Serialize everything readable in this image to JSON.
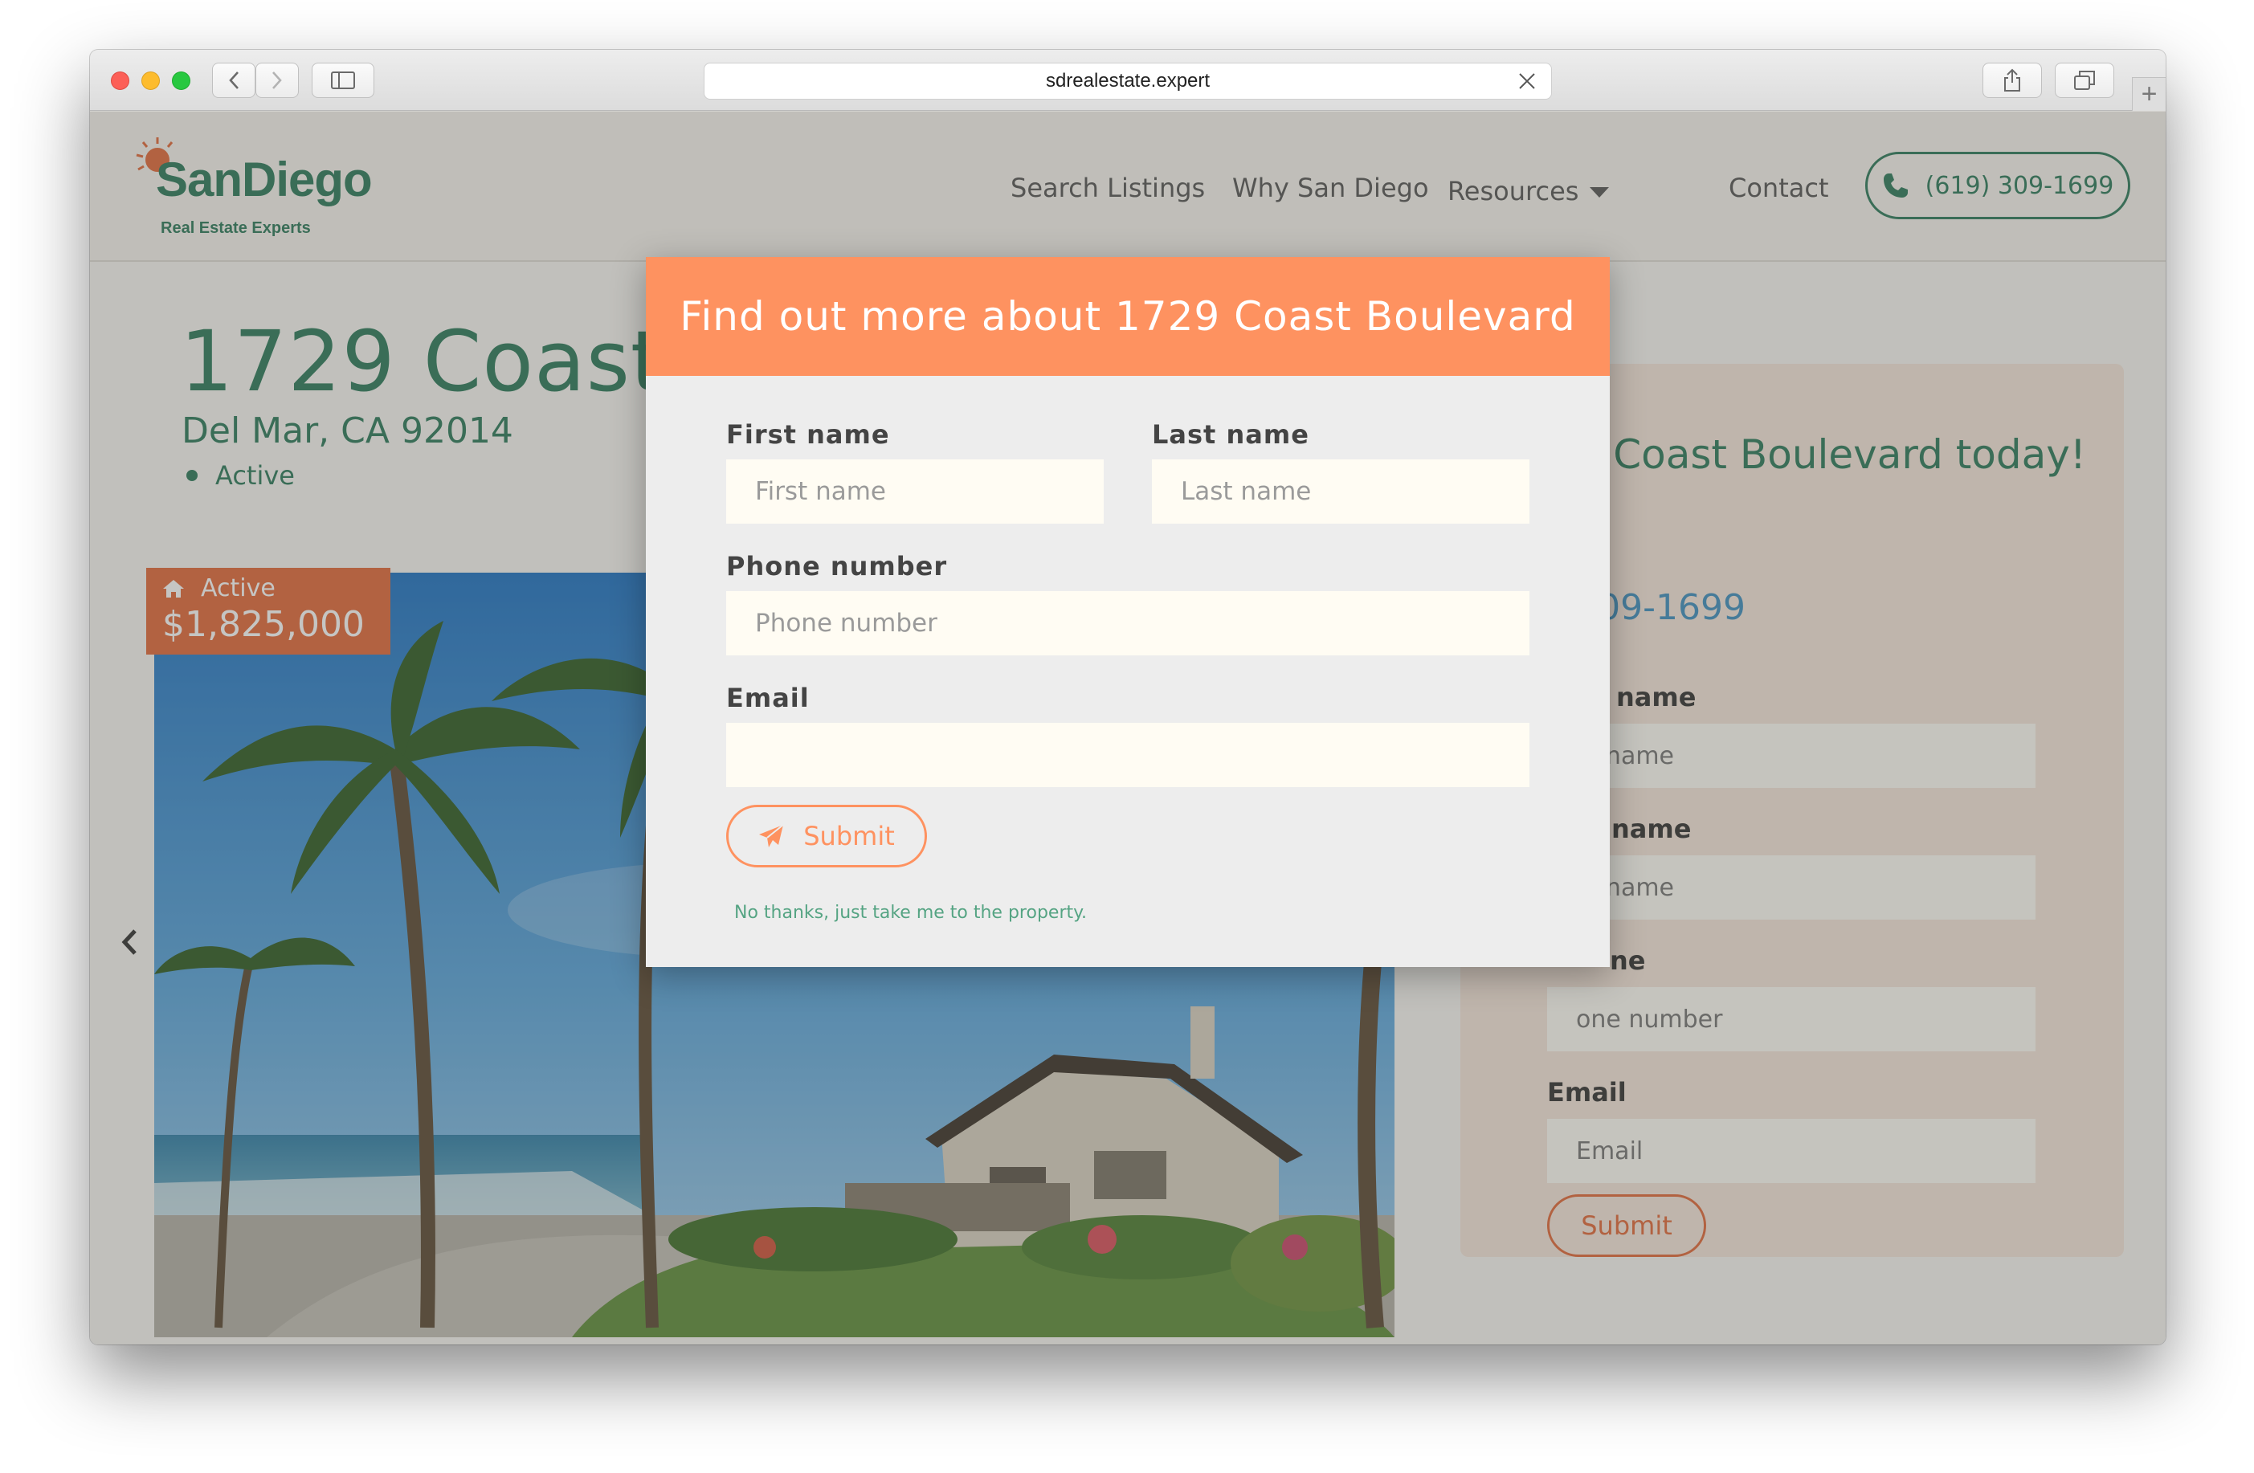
{
  "browser": {
    "url": "sdrealestate.expert",
    "new_tab_symbol": "+"
  },
  "site": {
    "logo": {
      "name": "SanDiego",
      "tagline": "Real Estate Experts"
    },
    "nav": {
      "search_listings": "Search Listings",
      "why_san_diego": "Why San Diego",
      "resources": "Resources",
      "contact": "Contact",
      "phone": "(619) 309-1699"
    },
    "colors": {
      "brand_green": "#2c7a5b",
      "accent_orange": "#fe9260",
      "badge_orange": "#e26a3b"
    }
  },
  "listing": {
    "title": "1729 Coast Boulevard",
    "city": "Del Mar, CA 92014",
    "status": "Active",
    "badge": {
      "status": "Active",
      "price": "$1,825,000"
    }
  },
  "side_form": {
    "title": "1729 Coast Boulevard today!",
    "cta_fragment": "v!",
    "phone_fragment": "9) 309-1699",
    "first_name_label_fragment": "name",
    "first_name_placeholder_fragment": "st name",
    "last_name_label_fragment": "name",
    "last_name_placeholder_fragment": "st name",
    "phone_label_fragment": "ne",
    "phone_placeholder_fragment": "one number",
    "email_label": "Email",
    "email_placeholder": "Email",
    "submit": "Submit"
  },
  "modal": {
    "title": "Find out more about 1729 Coast Boulevard",
    "first_name_label": "First name",
    "first_name_placeholder": "First name",
    "last_name_label": "Last name",
    "last_name_placeholder": "Last name",
    "phone_label": "Phone number",
    "phone_placeholder": "Phone number",
    "email_label": "Email",
    "email_value": "",
    "submit_label": "Submit",
    "no_thanks": "No thanks, just take me to the property."
  }
}
